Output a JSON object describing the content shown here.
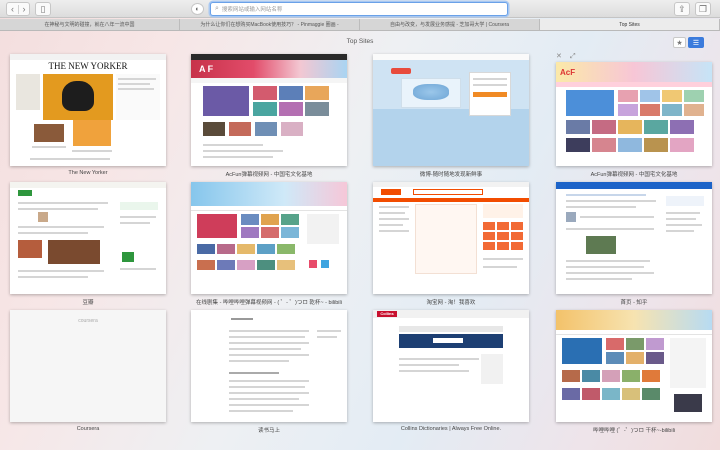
{
  "toolbar": {
    "search_placeholder": "搜索网站或输入网站名称",
    "colors": {
      "accent": "#3b7bdc",
      "focus_ring": "#6aa1e8"
    }
  },
  "tabs": [
    {
      "label": "在神秘与文明的碰撞，就在八年一流中国"
    },
    {
      "label": "为什么让你们在想购买MacBook使用技巧？ - Pinmaggie 圈画 -"
    },
    {
      "label": "自由与改变，与发展业务感提 - 芝加哥大学 | Coursera"
    },
    {
      "label": "Top Sites",
      "active": true
    }
  ],
  "page": {
    "title": "Top Sites"
  },
  "sites": [
    {
      "label": "The New Yorker",
      "icon": "new-yorker-thumb"
    },
    {
      "label": "AcFun弹幕视频网 - 中国宅文化基地",
      "icon": "acfun-thumb"
    },
    {
      "label": "微博-随时随地发现新鲜事",
      "icon": "weibo-thumb"
    },
    {
      "label": "AcFun弹幕视频网 - 中国宅文化基地",
      "icon": "acfun-thumb"
    },
    {
      "label": "豆瓣",
      "icon": "douban-thumb"
    },
    {
      "label": "在线剧集 - 哔哩哔哩弹幕视频网 - ( ゜- ゜)つロ 乾杯~ - bilibili",
      "icon": "bilibili-thumb"
    },
    {
      "label": "淘宝网 - 淘！我喜欢",
      "icon": "taobao-thumb"
    },
    {
      "label": "首页 - 知乎",
      "icon": "zhihu-thumb"
    },
    {
      "label": "Coursera",
      "icon": "coursera-thumb"
    },
    {
      "label": "读书马上",
      "icon": "reading-thumb"
    },
    {
      "label": "Collins Dictionaries | Always Free Online.",
      "icon": "collins-thumb"
    },
    {
      "label": "哔哩哔哩 (゜-゜)つロ 干杯~-bilibili",
      "icon": "bilibili-thumb"
    }
  ],
  "thumb_texts": {
    "new_yorker_masthead": "THE NEW YORKER",
    "acfun_logo": "A F",
    "collins_logo": "Collins",
    "coursera_logo": "coursera"
  }
}
